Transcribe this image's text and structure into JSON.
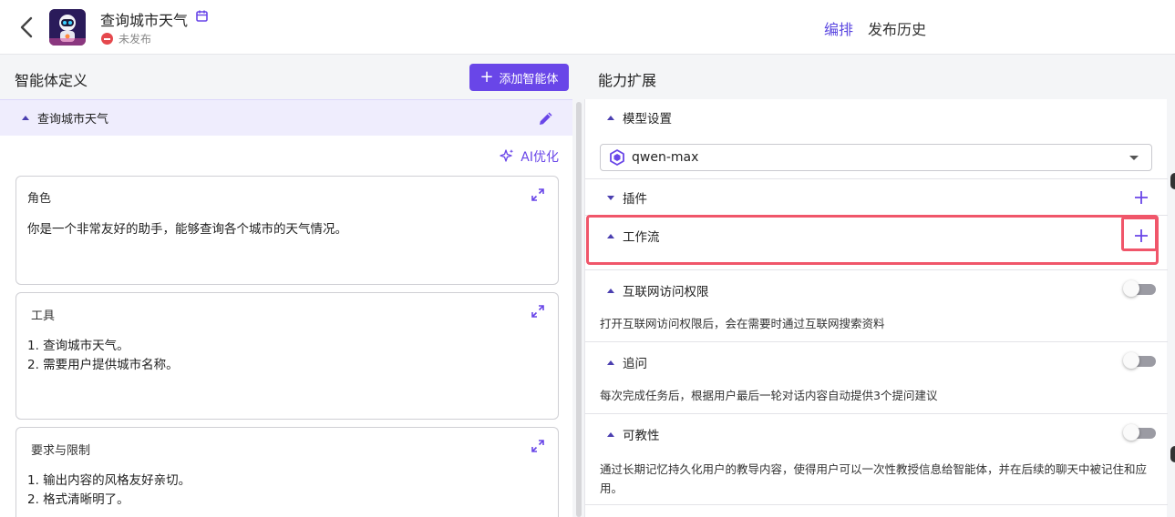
{
  "header": {
    "title": "查询城市天气",
    "status": "未发布",
    "nav": {
      "arrange": "编排",
      "history": "发布历史"
    }
  },
  "left": {
    "section_title": "智能体定义",
    "add_button": "添加智能体",
    "agent_name": "查询城市天气",
    "ai_optimize": "AI优化",
    "cards": {
      "role": {
        "title": "角色",
        "text": "你是一个非常友好的助手，能够查询各个城市的天气情况。"
      },
      "tools": {
        "title": "工具",
        "items": [
          "查询城市天气。",
          "需要用户提供城市名称。"
        ]
      },
      "constraints": {
        "title": "要求与限制",
        "items": [
          "输出内容的风格友好亲切。",
          "格式清晰明了。"
        ]
      }
    }
  },
  "right": {
    "section_title": "能力扩展",
    "model": {
      "title": "模型设置",
      "selected": "qwen-max"
    },
    "plugins": {
      "title": "插件"
    },
    "workflow": {
      "title": "工作流"
    },
    "internet": {
      "title": "互联网访问权限",
      "desc": "打开互联网访问权限后，会在需要时通过互联网搜索资料",
      "enabled": false
    },
    "followup": {
      "title": "追问",
      "desc": "每次完成任务后，根据用户最后一轮对话内容自动提供3个提问建议",
      "enabled": false
    },
    "teachable": {
      "title": "可教性",
      "desc": "通过长期记忆持久化用户的教导内容，使得用户可以一次性教授信息给智能体，并在后续的聊天中被记住和应用。",
      "enabled": false
    }
  },
  "colors": {
    "accent": "#6946e8",
    "highlight": "#f0566a",
    "status_red": "#e5484d"
  }
}
